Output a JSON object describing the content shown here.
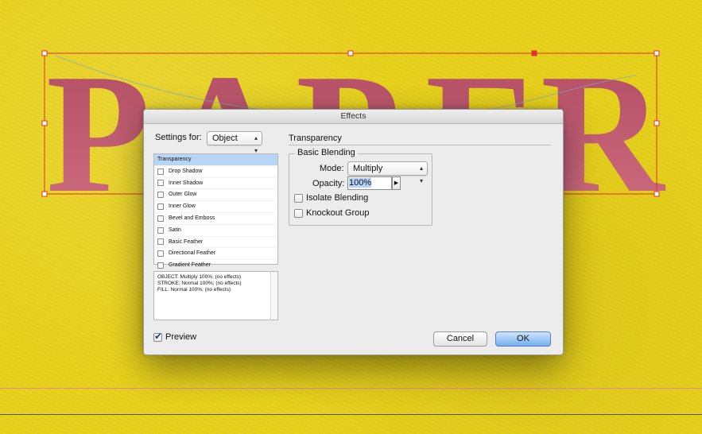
{
  "background": {
    "paper_letters": [
      "P",
      "A",
      "P",
      "E",
      "R"
    ],
    "colors": {
      "canvas": "#e8d21d",
      "letter_fill": "#c45a6e",
      "selection": "#e03030",
      "guide_pink": "#e58a9a"
    }
  },
  "dialog": {
    "title": "Effects",
    "settings_for_label": "Settings for:",
    "settings_for_value": "Object",
    "effects_list": [
      {
        "label": "Transparency",
        "selected": true,
        "checkbox": false
      },
      {
        "label": "Drop Shadow",
        "checkbox": true
      },
      {
        "label": "Inner Shadow",
        "checkbox": true
      },
      {
        "label": "Outer Glow",
        "checkbox": true
      },
      {
        "label": "Inner Glow",
        "checkbox": true
      },
      {
        "label": "Bevel and Emboss",
        "checkbox": true
      },
      {
        "label": "Satin",
        "checkbox": true
      },
      {
        "label": "Basic Feather",
        "checkbox": true
      },
      {
        "label": "Directional Feather",
        "checkbox": true
      },
      {
        "label": "Gradient Feather",
        "checkbox": true
      }
    ],
    "summary_lines": [
      "OBJECT: Multiply 100%; (no effects)",
      "STROKE: Normal 100%; (no effects)",
      "FILL: Normal 100%; (no effects)"
    ],
    "section_title": "Transparency",
    "group_title": "Basic Blending",
    "mode_label": "Mode:",
    "mode_value": "Multiply",
    "opacity_label": "Opacity:",
    "opacity_value": "100%",
    "isolate_blending_label": "Isolate Blending",
    "knockout_group_label": "Knockout Group",
    "preview_label": "Preview",
    "preview_checked": true,
    "cancel_label": "Cancel",
    "ok_label": "OK"
  }
}
